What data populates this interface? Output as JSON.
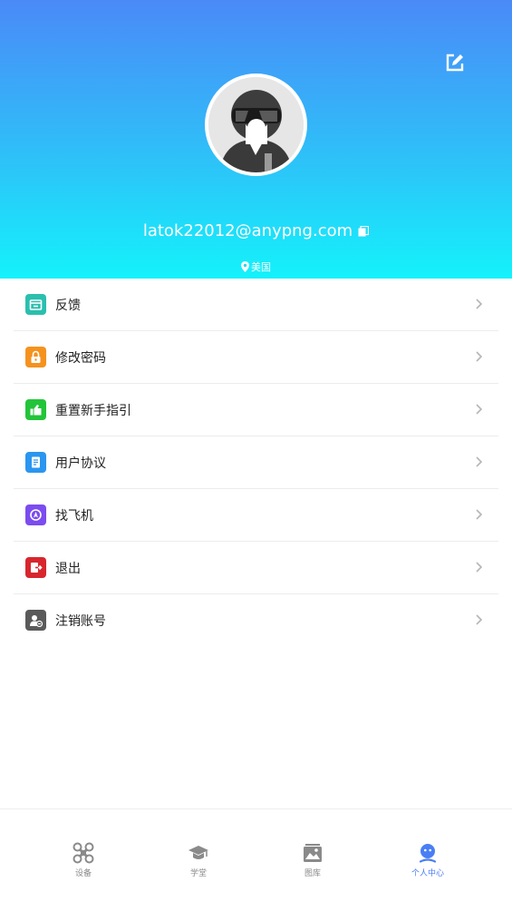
{
  "header": {
    "email": "latok22012@anypng.com",
    "location": "美国"
  },
  "menu": [
    {
      "label": "反馈",
      "icon": "feedback-icon",
      "color": "#2bbfae"
    },
    {
      "label": "修改密码",
      "icon": "lock-icon",
      "color": "#f5921e"
    },
    {
      "label": "重置新手指引",
      "icon": "thumb-guide-icon",
      "color": "#23c43a"
    },
    {
      "label": "用户协议",
      "icon": "document-icon",
      "color": "#2a96f0"
    },
    {
      "label": "找飞机",
      "icon": "find-drone-icon",
      "color": "#7b4cf0"
    },
    {
      "label": "退出",
      "icon": "logout-icon",
      "color": "#d7262d"
    },
    {
      "label": "注销账号",
      "icon": "delete-account-icon",
      "color": "#5a5a5a"
    }
  ],
  "tabs": [
    {
      "label": "设备",
      "icon": "drone-icon",
      "active": false
    },
    {
      "label": "学堂",
      "icon": "graduation-cap-icon",
      "active": false
    },
    {
      "label": "图库",
      "icon": "gallery-icon",
      "active": false
    },
    {
      "label": "个人中心",
      "icon": "profile-icon",
      "active": true
    }
  ],
  "colors": {
    "header_top": "#4a8af8",
    "header_bottom": "#14f2fb",
    "tab_active": "#4a7ef5",
    "tab_inactive": "#8a8a8a"
  }
}
